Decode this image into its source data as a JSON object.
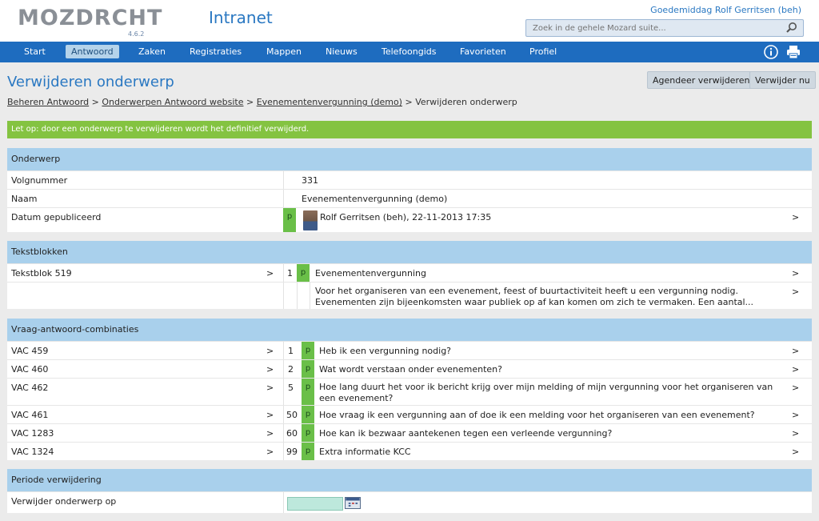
{
  "header": {
    "logo": "MOZDRCHT",
    "version": "4.6.2",
    "app_title": "Intranet",
    "greeting": "Goedemiddag Rolf Gerritsen (beh)",
    "search_placeholder": "Zoek in de gehele Mozard suite..."
  },
  "nav": {
    "items": [
      "Start",
      "Antwoord",
      "Zaken",
      "Registraties",
      "Mappen",
      "Nieuws",
      "Telefoongids",
      "Favorieten",
      "Profiel"
    ],
    "active": "Antwoord"
  },
  "page": {
    "title": "Verwijderen onderwerp",
    "buttons": {
      "schedule": "Agendeer verwijderen",
      "delete_now": "Verwijder nu"
    },
    "breadcrumb": [
      "Beheren Antwoord",
      "Onderwerpen Antwoord website",
      "Evenementenvergunning (demo)",
      "Verwijderen onderwerp"
    ],
    "alert": "Let op: door een onderwerp te verwijderen wordt het definitief verwijderd."
  },
  "onderwerp": {
    "heading": "Onderwerp",
    "rows": [
      {
        "label": "Volgnummer",
        "value": "331"
      },
      {
        "label": "Naam",
        "value": "Evenementenvergunning (demo)"
      },
      {
        "label": "Datum gepubliceerd",
        "badge": "p",
        "value": "Rolf Gerritsen (beh), 22-11-2013 17:35",
        "chevron": ">"
      }
    ]
  },
  "tekstblokken": {
    "heading": "Tekstblokken",
    "rows": [
      {
        "label": "Tekstblok 519",
        "chevron_left": ">",
        "num": "1",
        "badge": "p",
        "title": "Evenementenvergunning",
        "chevron": ">"
      },
      {
        "text": "Voor het organiseren van een evenement, feest of buurtactiviteit heeft u een vergunning nodig.  Evenementen zijn bijeenkomsten waar publiek op af kan komen om zich te vermaken.  Een aantal...",
        "chevron": ">"
      }
    ]
  },
  "vac": {
    "heading": "Vraag-antwoord-combinaties",
    "rows": [
      {
        "label": "VAC 459",
        "num": "1",
        "badge": "p",
        "question": "Heb ik een vergunning nodig?"
      },
      {
        "label": "VAC 460",
        "num": "2",
        "badge": "p",
        "question": "Wat wordt verstaan onder evenementen?"
      },
      {
        "label": "VAC 462",
        "num": "5",
        "badge": "p",
        "question": "Hoe lang duurt het voor ik bericht krijg over mijn melding of mijn vergunning voor het organiseren van een evenement?"
      },
      {
        "label": "VAC 461",
        "num": "50",
        "badge": "p",
        "question": "Hoe vraag ik een vergunning aan of doe ik een melding voor het organiseren van een evenement?"
      },
      {
        "label": "VAC 1283",
        "num": "60",
        "badge": "p",
        "question": "Hoe kan ik bezwaar aantekenen tegen een verleende vergunning?"
      },
      {
        "label": "VAC 1324",
        "num": "99",
        "badge": "p",
        "question": "Extra informatie KCC"
      }
    ],
    "chevron": ">"
  },
  "periode": {
    "heading": "Periode verwijdering",
    "label": "Verwijder onderwerp op",
    "date_value": ""
  },
  "colors": {
    "nav": "#1e6cbf",
    "section_head": "#a9d0ec",
    "alert": "#84c341",
    "badge": "#6abf48",
    "title": "#2a78c2"
  }
}
